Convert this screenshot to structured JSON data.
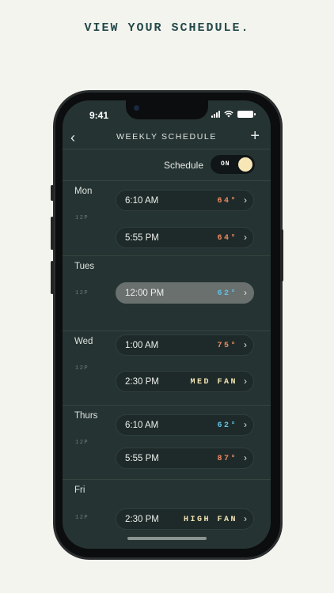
{
  "headline": "VIEW YOUR SCHEDULE.",
  "status": {
    "time": "9:41"
  },
  "nav": {
    "back_icon": "chevron-left-icon",
    "title": "WEEKLY SCHEDULE",
    "add_icon": "plus-icon"
  },
  "schedule_toggle": {
    "label": "Schedule",
    "state": "ON"
  },
  "noon_marker": "12P",
  "colors": {
    "warm": "#ee8a62",
    "cool": "#62bfe3",
    "fan": "#f2e3b0",
    "background": "#253433"
  },
  "days": [
    {
      "name": "Mon",
      "events": [
        {
          "time": "6:10 AM",
          "value": "64°",
          "kind": "warm"
        },
        {
          "time": "5:55 PM",
          "value": "64°",
          "kind": "warm"
        }
      ]
    },
    {
      "name": "Tues",
      "events": [
        {
          "time": "12:00 PM",
          "value": "62°",
          "kind": "cool",
          "selected": true
        }
      ]
    },
    {
      "name": "Wed",
      "events": [
        {
          "time": "1:00 AM",
          "value": "75°",
          "kind": "warm"
        },
        {
          "time": "2:30 PM",
          "value": "MED FAN",
          "kind": "fan"
        }
      ]
    },
    {
      "name": "Thurs",
      "events": [
        {
          "time": "6:10 AM",
          "value": "62°",
          "kind": "cool"
        },
        {
          "time": "5:55 PM",
          "value": "87°",
          "kind": "warm"
        }
      ]
    },
    {
      "name": "Fri",
      "events": [
        {
          "time": "2:30 PM",
          "value": "HIGH FAN",
          "kind": "fan"
        }
      ]
    }
  ]
}
